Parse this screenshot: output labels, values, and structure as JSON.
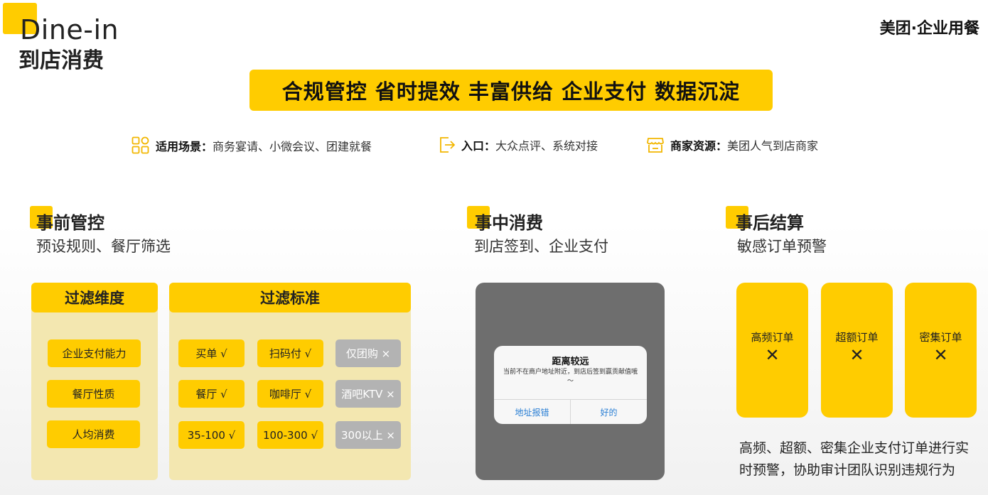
{
  "header": {
    "title_en": "Dine-in",
    "title_zh": "到店消费",
    "brand": "美团·企业用餐"
  },
  "banner": {
    "text": "合规管控 省时提效 丰富供给 企业支付 数据沉淀"
  },
  "info": [
    {
      "key": "适用场景：",
      "value": "商务宴请、小微会议、团建就餐",
      "icon": "grid-icon"
    },
    {
      "key": "入口：",
      "value": "大众点评、系统对接",
      "icon": "entry-arrow-icon"
    },
    {
      "key": "商家资源：",
      "value": "美团人气到店商家",
      "icon": "store-icon"
    }
  ],
  "sections": {
    "pre": {
      "title": "事前管控",
      "subtitle": "预设规则、餐厅筛选"
    },
    "mid": {
      "title": "事中消费",
      "subtitle": "到店签到、企业支付"
    },
    "post": {
      "title": "事后结算",
      "subtitle": "敏感订单预警"
    }
  },
  "filter_dimension": {
    "header": "过滤维度",
    "items": [
      "企业支付能力",
      "餐厅性质",
      "人均消费"
    ]
  },
  "filter_standard": {
    "header": "过滤标准",
    "rows": [
      [
        "买单 √",
        "扫码付 √",
        "仅团购 ×"
      ],
      [
        "餐厅 √",
        "咖啡厅 √",
        "酒吧KTV ×"
      ],
      [
        "35-100 √",
        "100-300 √",
        "300以上 ×"
      ]
    ]
  },
  "dialog": {
    "title": "距离较远",
    "message": "当前不在商户地址附近，到店后签到赢贡献值哦～",
    "left_button": "地址报错",
    "right_button": "好的"
  },
  "alerts": {
    "items": [
      {
        "label": "高频订单",
        "mark": "✕"
      },
      {
        "label": "超额订单",
        "mark": "✕"
      },
      {
        "label": "密集订单",
        "mark": "✕"
      }
    ],
    "description": "高频、超额、密集企业支付订单进行实时预警，协助审计团队识别违规行为"
  },
  "colors": {
    "accent": "#FFCC00",
    "panel_bg": "#F3E7B0",
    "disabled": "#B3B3B3",
    "phone_bg": "#6E6E6E",
    "link": "#2A7FD4"
  }
}
